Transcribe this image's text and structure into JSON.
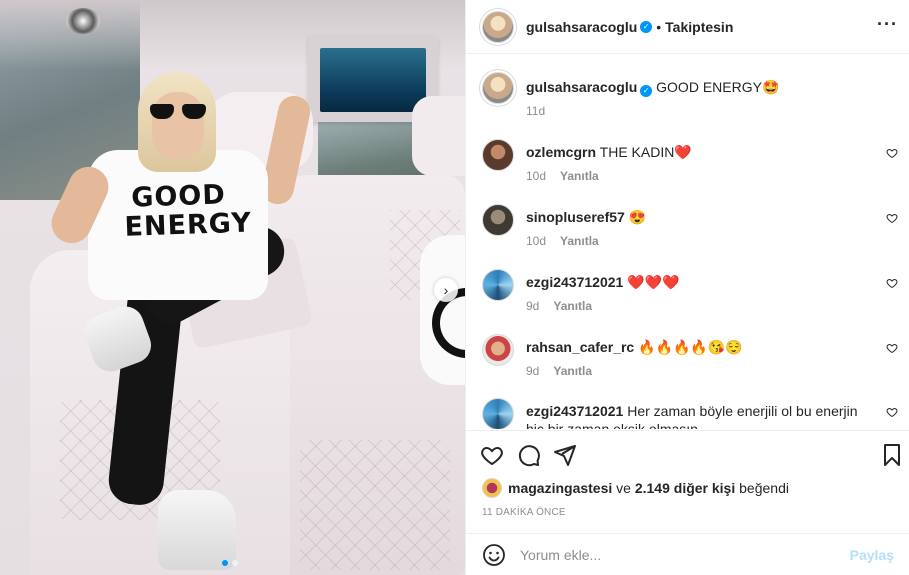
{
  "post": {
    "username": "gulsahsaracoglu",
    "follow_status": "Takiptesin",
    "caption": "GOOD ENERGY🤩",
    "caption_age": "11d",
    "shirt_text": "GOOD ENERGY"
  },
  "comments": [
    {
      "user": "ozlemcgrn",
      "text": "THE KADIN❤️",
      "age": "10d",
      "reply": "Yanıtla"
    },
    {
      "user": "sinopluseref57",
      "text": "😍",
      "age": "10d",
      "reply": "Yanıtla"
    },
    {
      "user": "ezgi243712021",
      "text": "❤️❤️❤️",
      "age": "9d",
      "reply": "Yanıtla"
    },
    {
      "user": "rahsan_cafer_rc",
      "text": "🔥🔥🔥🔥😘😌",
      "age": "9d",
      "reply": "Yanıtla"
    },
    {
      "user": "ezgi243712021",
      "text": "Her zaman böyle enerjili ol bu enerjin hiç bir zaman eksik olmasın",
      "age": "",
      "reply": ""
    }
  ],
  "likes": {
    "first_liker": "magazingastesi",
    "joiner": "ve",
    "others": "2.149 diğer kişi",
    "suffix": "beğendi"
  },
  "timestamp": "11 DAKİKA ÖNCE",
  "composer": {
    "placeholder": "Yorum ekle...",
    "post_label": "Paylaş"
  },
  "colors": {
    "accent": "#0095f6",
    "post_disabled": "#b2dffc",
    "muted": "#8e8e8e",
    "heart_red": "#ed4956"
  },
  "icons": [
    "verified-badge-icon",
    "more-options-icon",
    "heart-icon",
    "comment-icon",
    "share-icon",
    "save-icon",
    "emoji-icon",
    "chevron-right-icon"
  ]
}
